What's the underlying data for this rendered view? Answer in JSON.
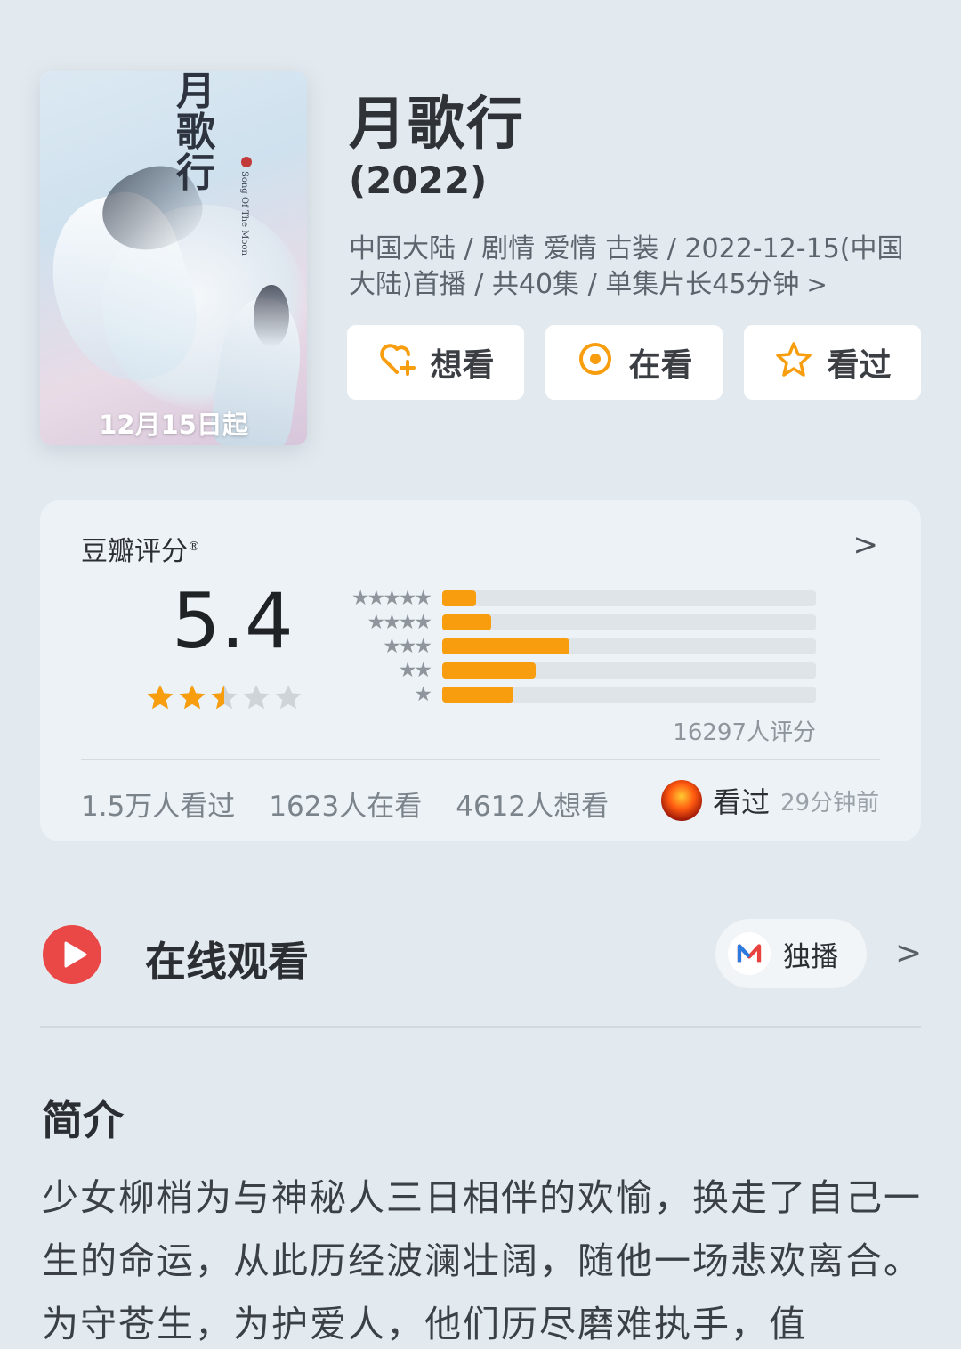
{
  "poster": {
    "calligraphy": "月歌行",
    "english_title": "Song Of The Moon",
    "date_text": "12月15日起"
  },
  "header": {
    "title": "月歌行",
    "year": "(2022)",
    "meta": "中国大陆 / 剧情 爱情 古装 / 2022-12-15(中国大陆)首播 / 共40集 / 单集片长45分钟"
  },
  "actions": [
    {
      "label": "想看",
      "icon": "heart-plus-icon"
    },
    {
      "label": "在看",
      "icon": "target-circle-icon"
    },
    {
      "label": "看过",
      "icon": "star-outline-icon"
    }
  ],
  "rating": {
    "title": "豆瓣评分",
    "trademark": "®",
    "score": "5.4",
    "score_stars": 2.5,
    "distribution": [
      {
        "stars": "★★★★★",
        "fraction": 0.09
      },
      {
        "stars": "★★★★",
        "fraction": 0.13
      },
      {
        "stars": "★★★",
        "fraction": 0.34
      },
      {
        "stars": "★★",
        "fraction": 0.25
      },
      {
        "stars": "★",
        "fraction": 0.19
      }
    ],
    "count": "16297人评分",
    "stats": [
      "1.5万人看过",
      "1623人在看",
      "4612人想看"
    ],
    "friend_status": "看过",
    "friend_time": "29分钟前"
  },
  "watch": {
    "title": "在线观看",
    "platform": "独播"
  },
  "synopsis": {
    "title": "简介",
    "body": "少女柳梢为与神秘人三日相伴的欢愉，换走了自己一生的命运，从此历经波澜壮阔，随他一场悲欢离合。为守苍生，为护爱人，他们历尽磨难执手，值"
  },
  "colors": {
    "background": "#e3eaef",
    "accent_orange": "#f79d0e",
    "play_red": "#ea4747",
    "star_gray": "#cfd4d9"
  }
}
